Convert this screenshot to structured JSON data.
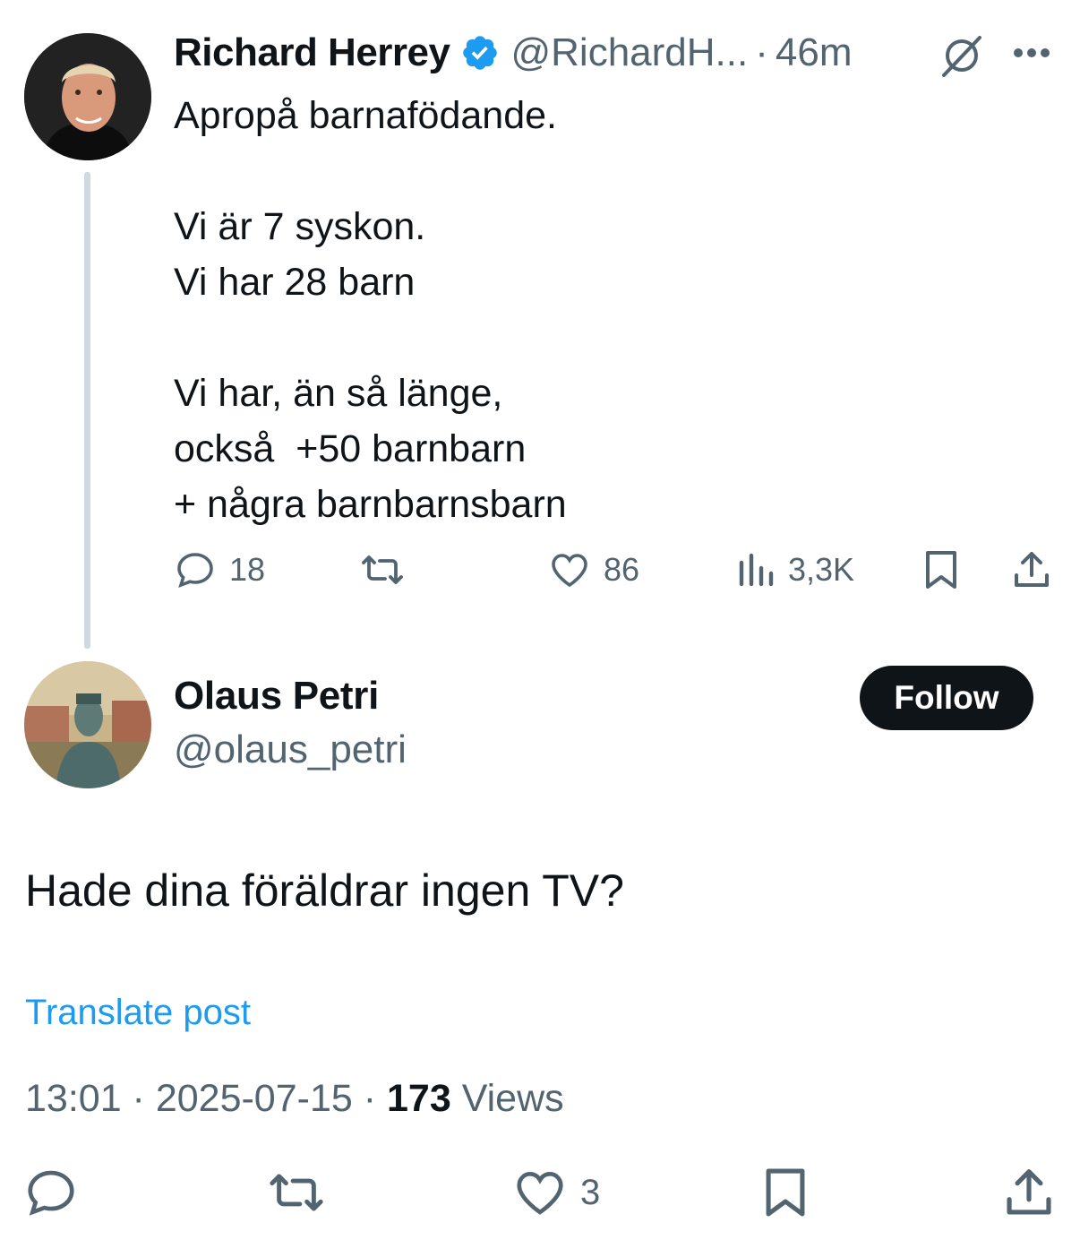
{
  "parent": {
    "author_name": "Richard Herrey",
    "handle": "@RichardH...",
    "separator": "·",
    "time_ago": "46m",
    "text": "Apropå barnafödande.\n\nVi är 7 syskon.\nVi har 28 barn\n\nVi har, än så länge,\nockså  +50 barnbarn\n+ några barnbarnsbarn",
    "actions": {
      "replies": "18",
      "retweets": "",
      "likes": "86",
      "views": "3,3K"
    }
  },
  "reply": {
    "author_name": "Olaus Petri",
    "handle": "@olaus_petri",
    "follow_label": "Follow",
    "text": "Hade dina föräldrar ingen TV?",
    "translate_label": "Translate post",
    "time": "13:01",
    "sep1": " · ",
    "date": "2025-07-15",
    "sep2": " · ",
    "views_count": "173",
    "views_label": " Views",
    "actions": {
      "likes": "3"
    }
  },
  "colors": {
    "text": "#0f1419",
    "grey": "#536471",
    "link": "#1d9bf0",
    "verified": "#1d9bf0",
    "thread_line": "#cfd9de"
  }
}
